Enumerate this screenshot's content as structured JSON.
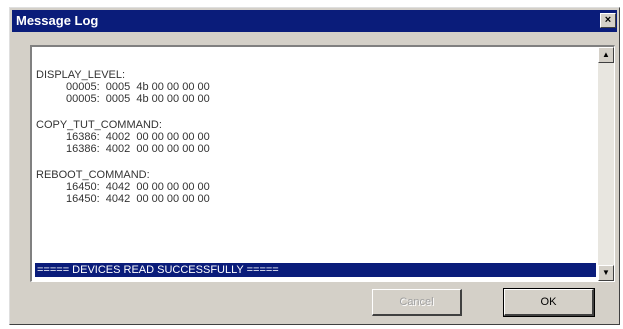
{
  "window": {
    "title": "Message Log",
    "close_glyph": "×"
  },
  "log": {
    "entries": [
      {
        "name": "DISPLAY_LEVEL:",
        "lines": [
          "00005:  0005  4b 00 00 00 00",
          "00005:  0005  4b 00 00 00 00"
        ]
      },
      {
        "name": "COPY_TUT_COMMAND:",
        "lines": [
          "16386:  4002  00 00 00 00 00",
          "16386:  4002  00 00 00 00 00"
        ]
      },
      {
        "name": "REBOOT_COMMAND:",
        "lines": [
          "16450:  4042  00 00 00 00 00",
          "16450:  4042  00 00 00 00 00"
        ]
      }
    ],
    "status_line": "===== DEVICES READ SUCCESSFULLY ====="
  },
  "scrollbar": {
    "up_glyph": "▲",
    "down_glyph": "▼"
  },
  "buttons": {
    "cancel_label": "Cancel",
    "ok_label": "OK"
  },
  "colors": {
    "titlebar": "#0a1c7a",
    "dialog_bg": "#d4d0c8",
    "highlight": "#0a1c7a"
  }
}
